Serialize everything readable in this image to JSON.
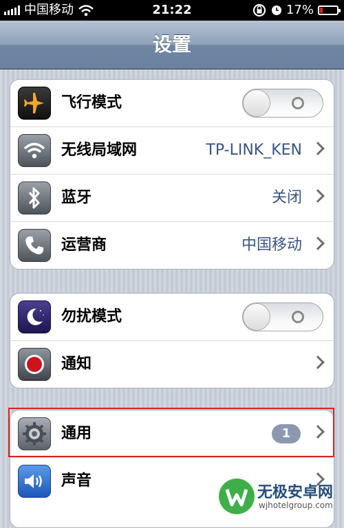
{
  "status_bar": {
    "carrier": "中国移动",
    "time": "21:22",
    "battery_percent": "17%",
    "battery_level": 0.17,
    "icons": [
      "signal-icon",
      "wifi-icon",
      "rotation-lock-icon",
      "alarm-icon",
      "battery-icon"
    ]
  },
  "nav": {
    "title": "设置"
  },
  "group1": [
    {
      "label": "飞行模式",
      "icon": "airplane-icon",
      "control": "toggle",
      "value": ""
    },
    {
      "label": "无线局域网",
      "icon": "wifi-icon",
      "control": "chevron",
      "value": "TP-LINK_KEN"
    },
    {
      "label": "蓝牙",
      "icon": "bluetooth-icon",
      "control": "chevron",
      "value": "关闭"
    },
    {
      "label": "运营商",
      "icon": "phone-icon",
      "control": "chevron",
      "value": "中国移动"
    }
  ],
  "group2": [
    {
      "label": "勿扰模式",
      "icon": "moon-icon",
      "control": "toggle",
      "value": ""
    },
    {
      "label": "通知",
      "icon": "notification-icon",
      "control": "chevron",
      "value": ""
    }
  ],
  "group3": [
    {
      "label": "通用",
      "icon": "gear-icon",
      "control": "badge",
      "badge": "1"
    },
    {
      "label": "声音",
      "icon": "speaker-icon",
      "control": "chevron"
    }
  ],
  "colors": {
    "highlight": "#d92323",
    "value_text": "#385487",
    "navbar": "#6f86a3"
  },
  "watermark": {
    "title": "无极安卓网",
    "url": "wjhotelgroup.com"
  }
}
